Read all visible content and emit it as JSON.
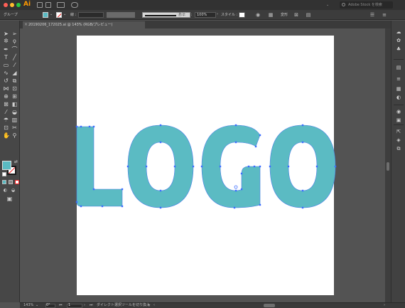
{
  "titlebar": {
    "app_logo": "Ai",
    "stock_search_placeholder": "Adobe Stock を検索",
    "traffic_lights": [
      "#fe5f57",
      "#febc2e",
      "#28c840"
    ]
  },
  "control": {
    "selection_label": "グループ",
    "stroke_label": "線 :",
    "stroke_profile_label": "基本",
    "opacity_label": "不透明度 :",
    "opacity_value": "100%",
    "style_label": "スタイル :",
    "transform_label": "変形",
    "fill_color": "#5bbbc3"
  },
  "document": {
    "tab_title": "20190206_172025.ai @ 143% (RGB/プレビュー)",
    "close_glyph": "×"
  },
  "artwork": {
    "logo_text": "LOGO",
    "logo_color": "#5bbbc3",
    "anchor_color": "#3b6cff"
  },
  "status": {
    "zoom": "143%",
    "rotation": "0°",
    "artboard_number": "1",
    "tool_hint": "ダイレクト選択ツールを切り換え"
  },
  "icons": {
    "selection": "selection-arrow-icon",
    "direct": "direct-selection-icon"
  }
}
